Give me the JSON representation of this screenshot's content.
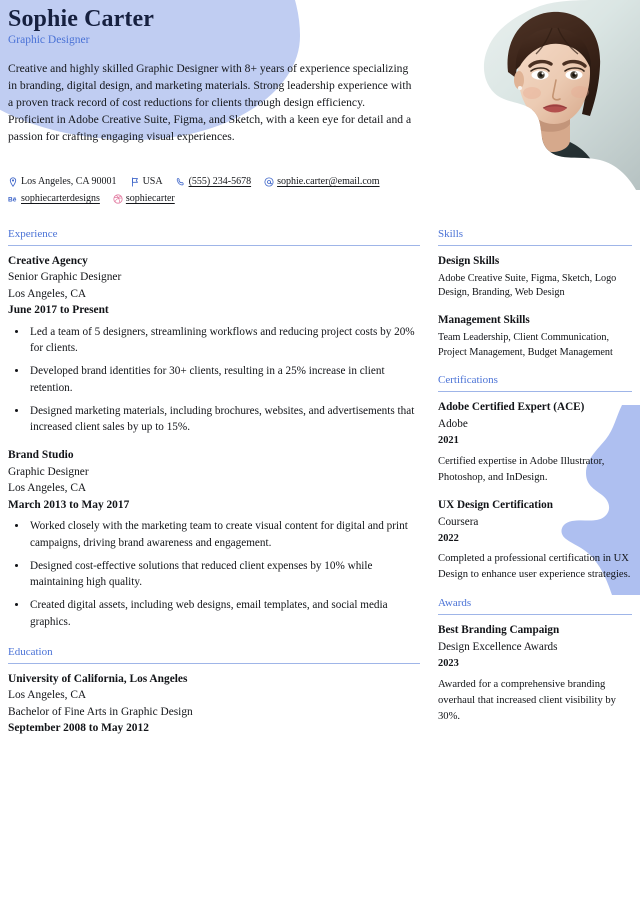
{
  "theme": {
    "accent_blue": "#4a72d6",
    "blob_blue": "#c0cdf2",
    "rule_blue": "#9fb5e8",
    "name_navy": "#16203f"
  },
  "header": {
    "name": "Sophie Carter",
    "job_title": "Graphic Designer",
    "summary": "Creative and highly skilled Graphic Designer with 8+ years of experience specializing in branding, digital design, and marketing materials. Strong leadership experience with a proven track record of cost reductions for clients through design efficiency. Proficient in Adobe Creative Suite, Figma, and Sketch, with a keen eye for detail and a passion for crafting engaging visual experiences.",
    "photo_alt": "portrait-photo"
  },
  "contacts": {
    "row1": [
      {
        "icon": "location-pin-icon",
        "text": "Los Angeles, CA 90001",
        "underline": false
      },
      {
        "icon": "flag-icon",
        "text": "USA",
        "underline": false
      },
      {
        "icon": "phone-icon",
        "text": "(555) 234-5678",
        "underline": true
      },
      {
        "icon": "email-icon",
        "text": "sophie.carter@email.com",
        "underline": true
      }
    ],
    "row2": [
      {
        "icon": "behance-icon",
        "text": "sophiecarterdesigns",
        "underline": true
      },
      {
        "icon": "dribbble-icon",
        "text": "sophiecarter",
        "underline": true
      }
    ]
  },
  "left_column": {
    "experience": {
      "title": "Experience",
      "entries": [
        {
          "organization": "Creative Agency",
          "role": "Senior Graphic Designer",
          "location": "Los Angeles, CA",
          "dates": "June 2017 to Present",
          "bullets": [
            "Led a team of 5 designers, streamlining workflows and reducing project costs by 20% for clients.",
            "Developed brand identities for 30+ clients, resulting in a 25% increase in client retention.",
            "Designed marketing materials, including brochures, websites, and advertisements that increased client sales by up to 15%."
          ]
        },
        {
          "organization": "Brand Studio",
          "role": "Graphic Designer",
          "location": "Los Angeles, CA",
          "dates": "March 2013 to May 2017",
          "bullets": [
            "Worked closely with the marketing team to create visual content for digital and print campaigns, driving brand awareness and engagement.",
            "Designed cost-effective solutions that reduced client expenses by 10% while maintaining high quality.",
            "Created digital assets, including web designs, email templates, and social media graphics."
          ]
        }
      ]
    },
    "education": {
      "title": "Education",
      "entries": [
        {
          "organization": "University of California, Los Angeles",
          "location": "Los Angeles, CA",
          "degree": "Bachelor of Fine Arts in Graphic Design",
          "dates": "September 2008 to May 2012"
        }
      ]
    }
  },
  "right_column": {
    "skills": {
      "title": "Skills",
      "groups": [
        {
          "name": "Design Skills",
          "items": "Adobe Creative Suite, Figma, Sketch, Logo Design, Branding, Web Design"
        },
        {
          "name": "Management Skills",
          "items": "Team Leadership, Client Communication, Project Management, Budget Management"
        }
      ]
    },
    "certifications": {
      "title": "Certifications",
      "entries": [
        {
          "name": "Adobe Certified Expert (ACE)",
          "issuer": "Adobe",
          "year": "2021",
          "description": "Certified expertise in Adobe Illustrator, Photoshop, and InDesign."
        },
        {
          "name": "UX Design Certification",
          "issuer": "Coursera",
          "year": "2022",
          "description": "Completed a professional certification in UX Design to enhance user experience strategies."
        }
      ]
    },
    "awards": {
      "title": "Awards",
      "entries": [
        {
          "name": "Best Branding Campaign",
          "issuer": "Design Excellence Awards",
          "year": "2023",
          "description": "Awarded for a comprehensive branding overhaul that increased client visibility by 30%."
        }
      ]
    }
  }
}
